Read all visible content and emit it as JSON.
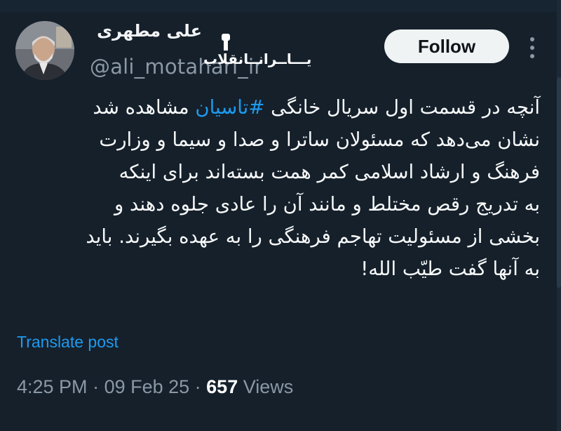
{
  "author": {
    "display_name": "علی مطهری",
    "handle": "@ali_motahari_ir"
  },
  "watermark": {
    "text": "یـــاــرانــانقلاب"
  },
  "actions": {
    "follow_label": "Follow",
    "more_icon": "more-vertical-icon"
  },
  "tweet": {
    "line_1_a": "آنچه در قسمت اول سریال خانگی ",
    "hashtag": "#تاسیان",
    "line_1_b": " مشاهده شد",
    "line_2": "نشان می‌دهد که مسئولان ساترا و صدا و سیما و وزارت",
    "line_3": "فرهنگ و ارشاد اسلامی کمر همت بسته‌اند برای اینکه",
    "line_4": "به تدریج رقص مختلط و مانند آن را عادی جلوه دهند و",
    "line_5": "بخشی از مسئولیت تهاجم فرهنگی را به عهده بگیرند. باید",
    "line_6": "به آنها گفت طیّب الله!"
  },
  "translate": {
    "label": "Translate post"
  },
  "meta": {
    "time": "4:25 PM",
    "sep_1": " · ",
    "date": "09 Feb 25",
    "sep_2": " · ",
    "views_count": "657",
    "views_label": " Views"
  },
  "colors": {
    "background": "#15202b",
    "accent": "#1d9bf0",
    "muted": "#8b98a5"
  }
}
